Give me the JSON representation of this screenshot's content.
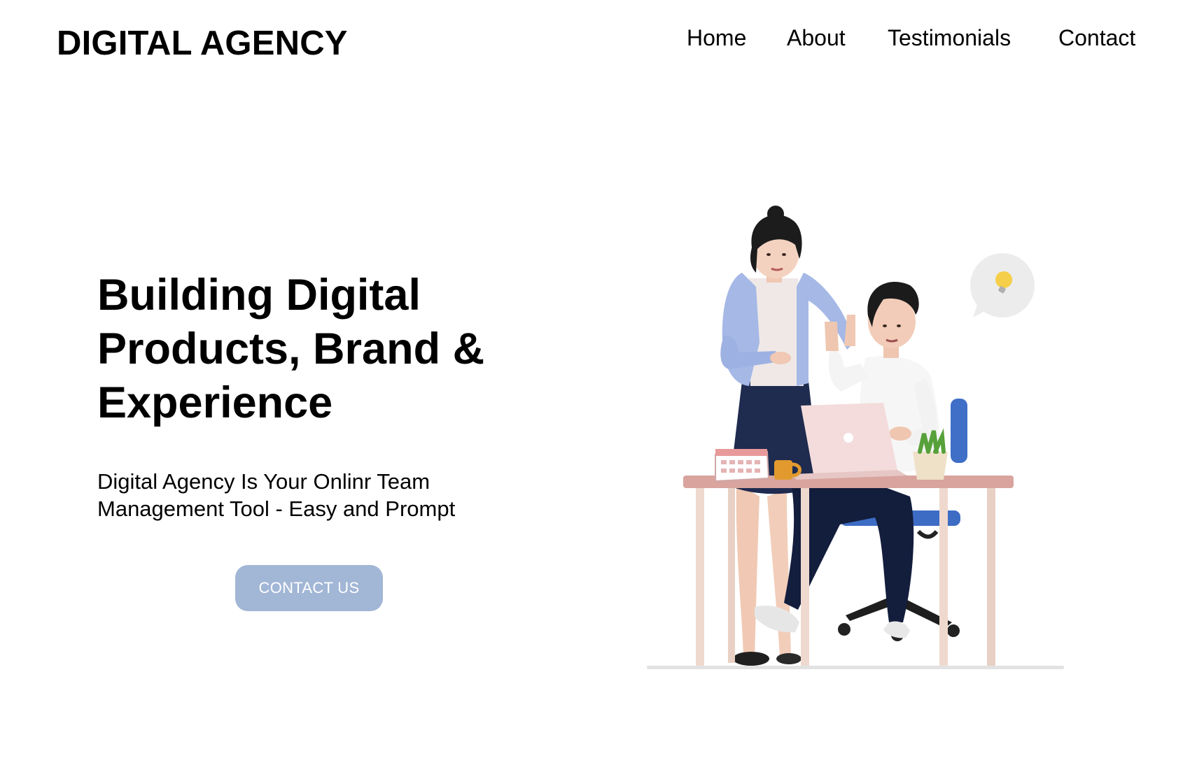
{
  "header": {
    "logo": "DIGITAL AGENCY",
    "nav": [
      {
        "label": "Home"
      },
      {
        "label": "About"
      },
      {
        "label": "Testimonials"
      },
      {
        "label": "Contact"
      }
    ]
  },
  "hero": {
    "title": "Building Digital Products, Brand & Experience",
    "subtitle": "Digital Agency Is Your Onlinr Team Management Tool - Easy and Prompt",
    "cta_label": "CONTACT US"
  },
  "illustration": {
    "icon": "team-at-desk-illustration",
    "bubble_icon": "lightbulb-icon"
  },
  "colors": {
    "cta_background": "#a2b6d6",
    "cta_text": "#ffffff",
    "text": "#000000",
    "background": "#ffffff"
  }
}
